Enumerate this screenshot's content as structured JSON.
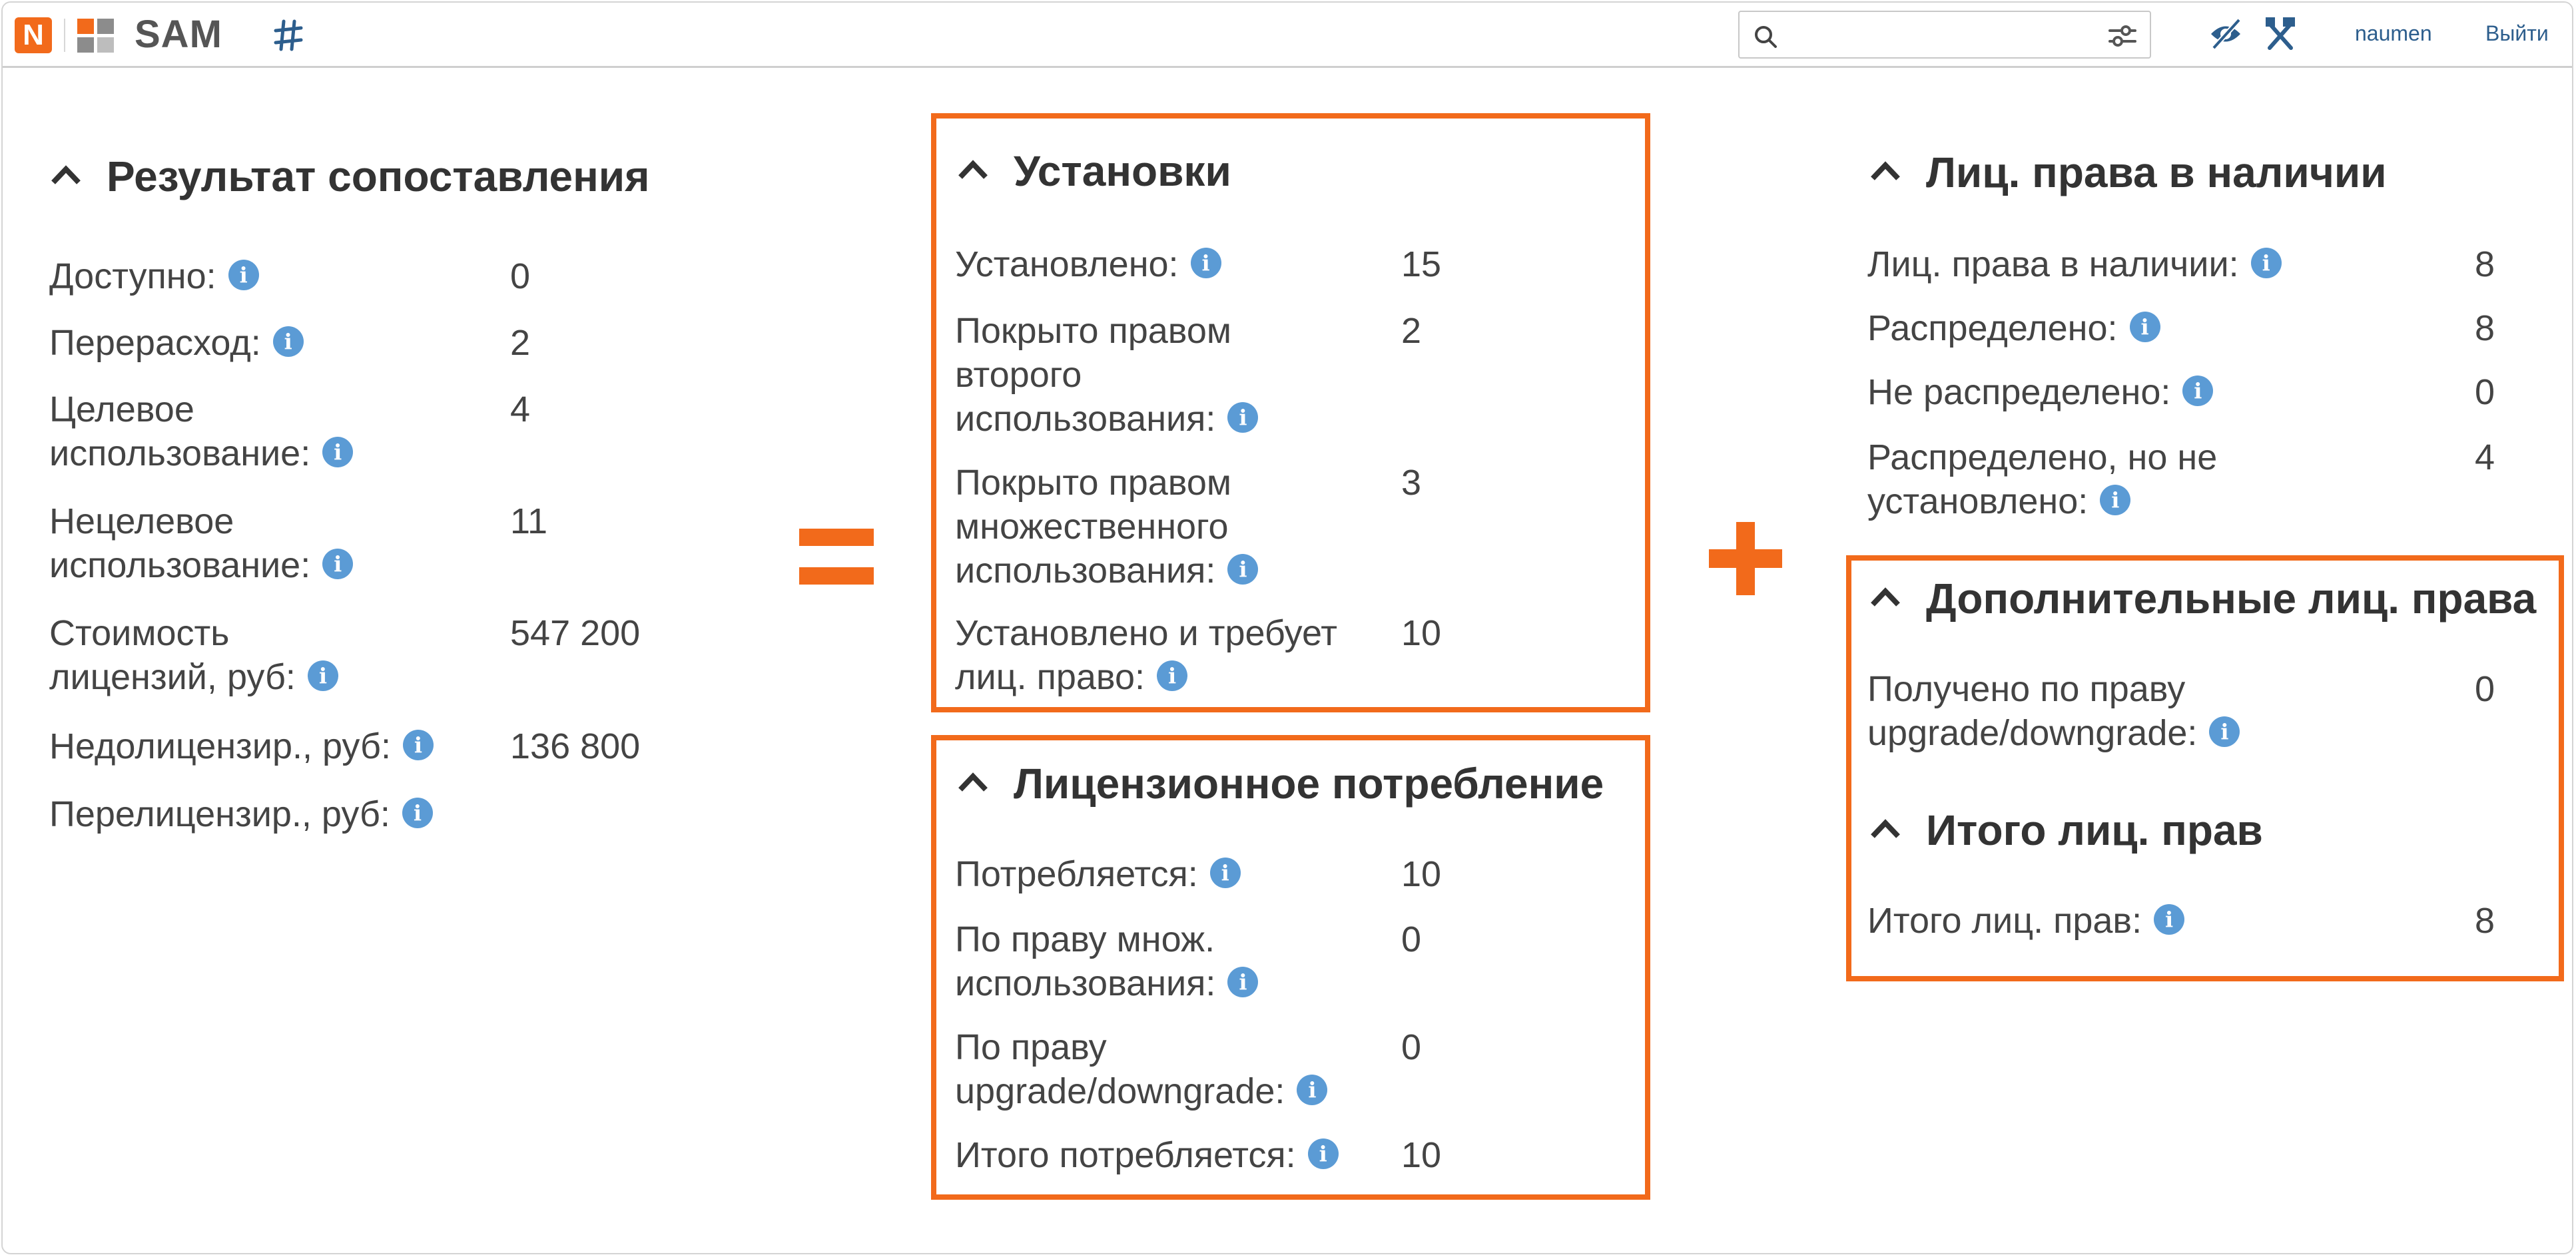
{
  "header": {
    "app_name": "SAM",
    "logo_letter": "N",
    "search_placeholder": "",
    "user": "naumen",
    "logout": "Выйти"
  },
  "colors": {
    "accent": "#f26a1b",
    "info": "#5b9bd5",
    "link": "#2d5e8d"
  },
  "icons": [
    "search-icon",
    "filter-icon",
    "eye-off-icon",
    "tools-icon",
    "hash-icon",
    "info-icon",
    "chevron-up-icon"
  ],
  "result": {
    "title": "Результат сопоставления",
    "rows": [
      {
        "label": "Доступно:",
        "value": "0"
      },
      {
        "label": "Перерасход:",
        "value": "2"
      },
      {
        "label": "Целевое использование:",
        "value": "4"
      },
      {
        "label": "Нецелевое использование:",
        "value": "11"
      },
      {
        "label": "Стоимость лицензий, руб:",
        "value": "547 200"
      },
      {
        "label": "Недолицензир., руб:",
        "value": "136 800"
      },
      {
        "label": "Перелицензир., руб:",
        "value": ""
      }
    ]
  },
  "equals_sign": "=",
  "plus_sign": "+",
  "installs": {
    "title": "Установки",
    "rows": [
      {
        "label": "Установлено:",
        "value": "15"
      },
      {
        "label": "Покрыто правом второго использования:",
        "value": "2"
      },
      {
        "label": "Покрыто правом множественного использования:",
        "value": "3"
      },
      {
        "label": "Установлено и требует лиц. право:",
        "value": "10"
      }
    ]
  },
  "consumption": {
    "title": "Лицензионное потребление",
    "rows": [
      {
        "label": "Потребляется:",
        "value": "10"
      },
      {
        "label": "По праву множ. использования:",
        "value": "0"
      },
      {
        "label": "По праву upgrade/downgrade:",
        "value": "0"
      },
      {
        "label": "Итого потребляется:",
        "value": "10"
      }
    ]
  },
  "available": {
    "title": "Лиц. права в наличии",
    "rows": [
      {
        "label": "Лиц. права в наличии:",
        "value": "8"
      },
      {
        "label": "Распределено:",
        "value": "8"
      },
      {
        "label": "Не распределено:",
        "value": "0"
      },
      {
        "label": "Распределено, но не установлено:",
        "value": "4"
      }
    ]
  },
  "additional": {
    "title": "Дополнительные лиц. права",
    "rows": [
      {
        "label": "Получено по праву upgrade/downgrade:",
        "value": "0"
      }
    ]
  },
  "total": {
    "title": "Итого лиц. прав",
    "rows": [
      {
        "label": "Итого лиц. прав:",
        "value": "8"
      }
    ]
  }
}
